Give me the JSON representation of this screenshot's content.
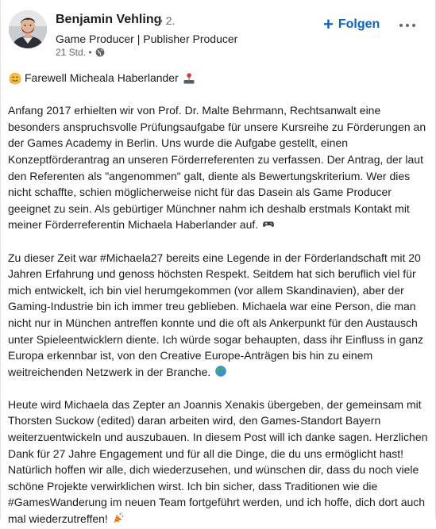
{
  "author": {
    "name": "Benjamin Vehling",
    "degree": "• 2.",
    "headline": "Game Producer | Publisher Producer",
    "time": "21 Std. •"
  },
  "actions": {
    "follow_label": "Folgen"
  },
  "colors": {
    "accent": "#0a66c2",
    "text": "#1d1d1d",
    "muted": "#666666"
  },
  "post": {
    "title": "Farewell Micheala Haberlander",
    "p1": [
      "Anfang 2017 erhielten wir von Prof. Dr. Malte Behrmann, Rechtsanwalt eine",
      "besonders anspruchsvolle Prüfungsaufgabe für unsere Kursreihe zu Förderungen an",
      "der Games Academy in Berlin. Uns wurde die Aufgabe gestellt, einen",
      "Konzeptförderantrag an unseren Förderreferenten zu verfassen. Der Antrag, der laut",
      "den Referenten als \"angenommen\" galt, diente als Bewertungskriterium. Wer dies",
      "nicht schaffte, schien möglicherweise nicht für das Dasein als Game Producer",
      "geeignet zu sein. Als gebürtiger Münchner nahm ich deshalb erstmals Kontakt mit",
      "meiner Förderreferentin Michaela Haberlander auf."
    ],
    "p2": [
      "Zu dieser Zeit war #Michaela27 bereits eine Legende in der Förderlandschaft mit 20",
      "Jahren Erfahrung und genoss höchsten Respekt. Seitdem hat sich beruflich viel für",
      "mich entwickelt, ich bin viel herumgekommen (vor allem Skandinavien), aber der",
      "Gaming-Industrie bin ich immer treu geblieben. Michaela war eine Person, die man",
      "nicht nur in München antreffen konnte und die oft als Ankerpunkt für den Austausch",
      "unter Spieleentwicklern diente. Ich würde sogar behaupten, dass ihr Einfluss in ganz",
      "Europa erkennbar ist, von den Creative Europe-Anträgen bis hin zu einem",
      "weitreichenden Netzwerk in der Branche."
    ],
    "p3": [
      "Heute wird Michaela das Zepter an Joannis Xenakis übergeben, der gemeinsam mit",
      "Thorsten Suckow (edited) daran arbeiten wird, den Games-Standort Bayern",
      "weiterzuentwickeln und auszubauen. In diesem Post will ich danke sagen. Herzlichen",
      "Dank für 27 Jahre Engagement und für all die Dinge, die du uns ermöglicht hast!",
      "Natürlich hoffen wir alle, dich wiederzusehen, und wünschen dir, dass du noch viele",
      "schöne Projekte verwirklichen wirst. Ich bin sicher, dass Traditionen wie die",
      "#GamesWanderung im neuen Team fortgeführt werden, und ich hoffe, dich dort auch",
      "mal wiederzutreffen!"
    ]
  }
}
